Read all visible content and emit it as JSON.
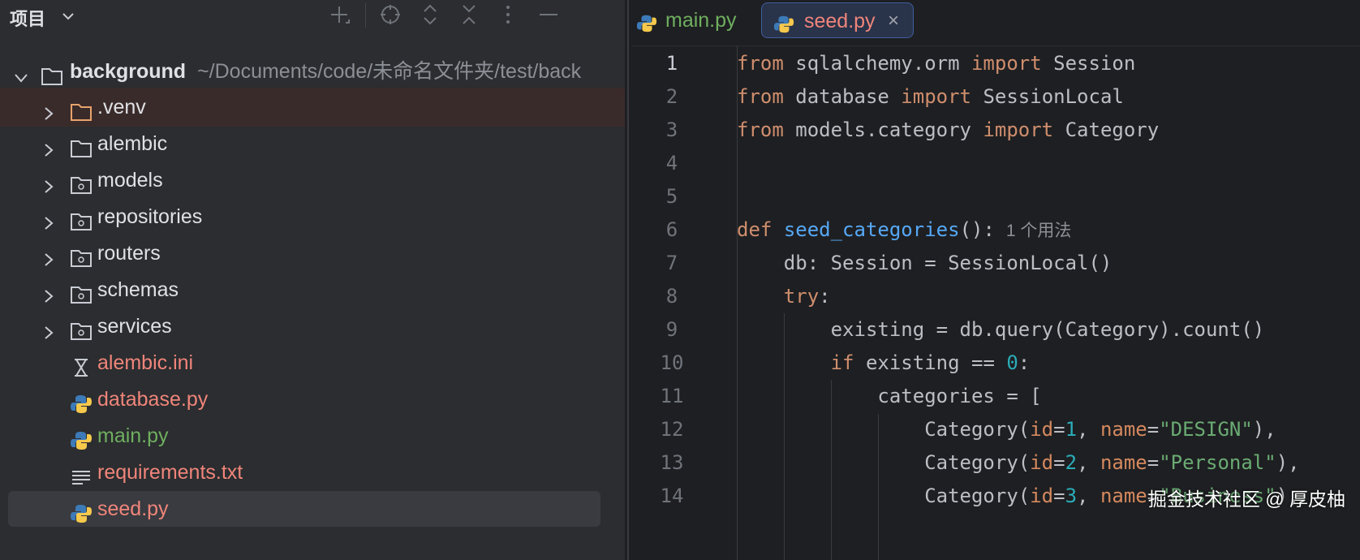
{
  "panel": {
    "title": "项目",
    "toolbar_icons": [
      "add-icon",
      "locate-icon",
      "expand-collapse-icon",
      "collapse-all-icon",
      "more-icon",
      "minimize-icon"
    ]
  },
  "tree": {
    "root": {
      "name": "background",
      "path": "~/Documents/code/未命名文件夹/test/back"
    },
    "items": [
      {
        "label": ".venv",
        "kind": "folder-excluded"
      },
      {
        "label": "alembic",
        "kind": "folder"
      },
      {
        "label": "models",
        "kind": "package"
      },
      {
        "label": "repositories",
        "kind": "package"
      },
      {
        "label": "routers",
        "kind": "package"
      },
      {
        "label": "schemas",
        "kind": "package"
      },
      {
        "label": "services",
        "kind": "package"
      },
      {
        "label": "alembic.ini",
        "kind": "ini"
      },
      {
        "label": "database.py",
        "kind": "python"
      },
      {
        "label": "main.py",
        "kind": "python"
      },
      {
        "label": "requirements.txt",
        "kind": "text"
      },
      {
        "label": "seed.py",
        "kind": "python"
      }
    ]
  },
  "tabs": [
    {
      "label": "main.py",
      "active": false
    },
    {
      "label": "seed.py",
      "active": true,
      "close": "×"
    }
  ],
  "code": {
    "line_numbers": [
      "1",
      "2",
      "3",
      "4",
      "5",
      "6",
      "7",
      "8",
      "9",
      "10",
      "11",
      "12",
      "13",
      "14"
    ],
    "lines": [
      "from sqlalchemy.orm import Session",
      "from database import SessionLocal",
      "from models.category import Category",
      "",
      "",
      "def seed_categories():",
      "    db: Session = SessionLocal()",
      "    try:",
      "        existing = db.query(Category).count()",
      "        if existing == 0:",
      "            categories = [",
      "                Category(id=1, name=\"DESIGN\"),",
      "                Category(id=2, name=\"Personal\"),",
      "                Category(id=3, name=\"Business\"),"
    ],
    "usage_hint": "1 个用法"
  },
  "watermark": "掘金技术社区 @ 厚皮柚",
  "colors": {
    "keyword": "#cf8e6d",
    "function": "#56a8f5",
    "number": "#2aacb8",
    "string": "#6aab73",
    "param": "#aa4926",
    "new_file": "#6faf5f",
    "modified_file": "#f0857a",
    "excluded": "#e8a36b"
  }
}
